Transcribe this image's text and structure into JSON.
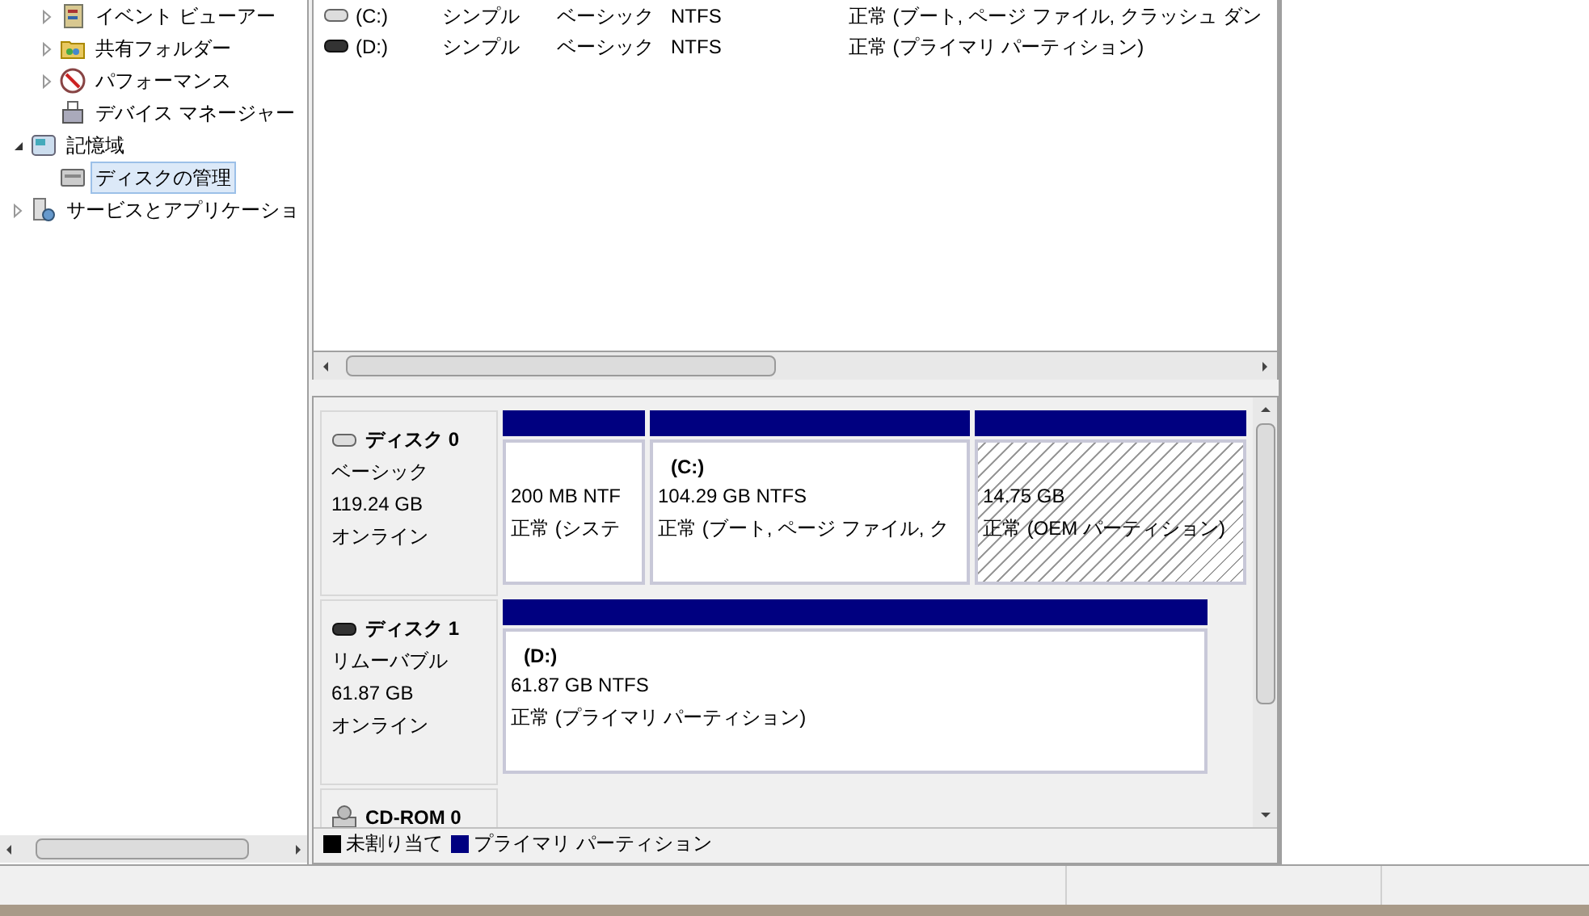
{
  "tree": [
    {
      "children": [
        {
          "label": "イベント ビューアー",
          "expanded": false,
          "kind": "event"
        },
        {
          "label": "共有フォルダー",
          "expanded": false,
          "kind": "folder"
        },
        {
          "label": "パフォーマンス",
          "expanded": false,
          "kind": "perf"
        },
        {
          "label": "デバイス マネージャー",
          "kind": "device"
        }
      ]
    },
    {
      "label": "記憶域",
      "expanded": true,
      "kind": "storage",
      "children": [
        {
          "label": "ディスクの管理",
          "selected": true,
          "kind": "disk"
        }
      ]
    },
    {
      "label": "サービスとアプリケーショ",
      "expanded": false,
      "kind": "services"
    }
  ],
  "volume_list": {
    "rows": [
      {
        "kind": "fixed",
        "cells": [
          "(C:)",
          "シンプル",
          "ベーシック",
          "NTFS",
          "正常 (ブート, ページ ファイル, クラッシュ ダン"
        ]
      },
      {
        "kind": "removable",
        "cells": [
          "(D:)",
          "シンプル",
          "ベーシック",
          "NTFS",
          "正常 (プライマリ パーティション)"
        ]
      }
    ]
  },
  "disks": [
    {
      "kind": "fixed",
      "name": "ディスク 0",
      "type": "ベーシック",
      "size": "119.24 GB",
      "state": "オンライン",
      "partitions": [
        {
          "kind": "primary",
          "size": "200 MB NTF",
          "status": "正常 (システ"
        },
        {
          "kind": "primary",
          "label": "(C:)",
          "size": "104.29 GB NTFS",
          "status": "正常 (ブート, ページ ファイル, ク"
        },
        {
          "kind": "oem",
          "size": "14.75 GB",
          "status": "正常 (OEM パーティション)"
        }
      ]
    },
    {
      "kind": "removable",
      "name": "ディスク 1",
      "type": "リムーバブル",
      "size": "61.87 GB",
      "state": "オンライン",
      "partitions": [
        {
          "kind": "primary",
          "label": "(D:)",
          "size": "61.87 GB NTFS",
          "status": "正常 (プライマリ パーティション)"
        }
      ]
    },
    {
      "kind": "cdrom",
      "name": "CD-ROM 0"
    }
  ],
  "legend": [
    {
      "label": "未割り当て",
      "color": "#000000"
    },
    {
      "label": "プライマリ パーティション",
      "color": "#000080"
    }
  ]
}
